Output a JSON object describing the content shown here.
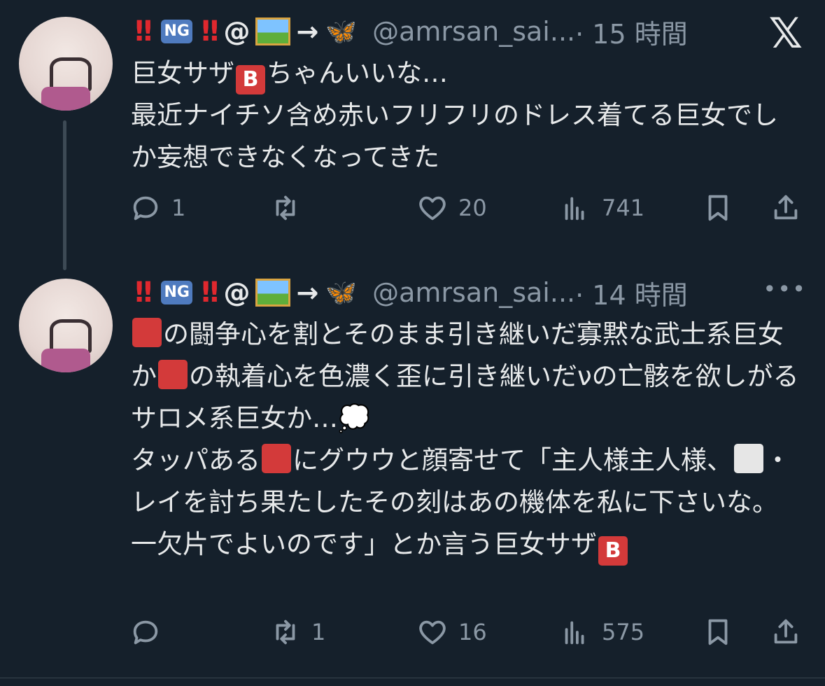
{
  "tweets": [
    {
      "display_name_tail": "@",
      "ng": "NG",
      "handle": "@amrsan_sai...",
      "time": "· 15 時間",
      "text": {
        "l1a": "巨女サザ",
        "l1b": "B",
        "l1c": "ちゃんいいな…",
        "l2": "最近ナイチソ含め赤いフリフリのドレス着てる巨女でしか妄想できなくなってきた"
      },
      "stats": {
        "reply": "1",
        "retweet": "",
        "like": "20",
        "views": "741"
      }
    },
    {
      "display_name_tail": "@",
      "ng": "NG",
      "handle": "@amrsan_sai...",
      "time": "· 14 時間",
      "text": {
        "l1": "の闘争心を割とそのまま引き継いだ寡黙な武士系巨女か",
        "l2": "の執着心を色濃く歪に引き継いだνの亡骸を欲しがるサロメ系巨女か…",
        "l3a": "タッパある",
        "l3b": "にグウウと顔寄せて「主人様主人様、",
        "l3c": "・レイを討ち果たしたその刻はあの機体を私に下さいな。一欠片でよいのです」とか言う巨女サザ",
        "b": "B"
      },
      "stats": {
        "reply": "",
        "retweet": "1",
        "like": "16",
        "views": "575"
      }
    }
  ],
  "icons": {
    "logo": "x-logo-icon",
    "more": "more-icon",
    "reply": "reply-icon",
    "retweet": "retweet-icon",
    "like": "heart-icon",
    "views": "views-icon",
    "bookmark": "bookmark-icon",
    "share": "share-icon"
  },
  "colors": {
    "background": "#15202b",
    "text": "#e7e9ea",
    "secondary": "#8b98a5"
  }
}
